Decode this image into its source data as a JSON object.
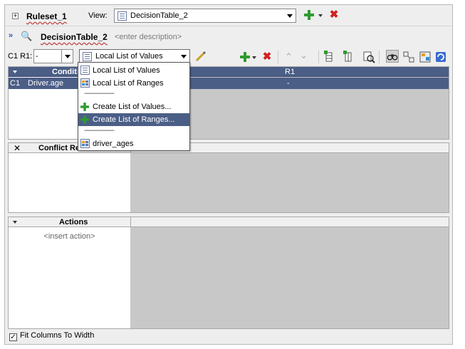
{
  "ruleset": {
    "title": "Ruleset_1",
    "view_label": "View:",
    "view_value": "DecisionTable_2"
  },
  "decision_table": {
    "title": "DecisionTable_2",
    "description_placeholder": "<enter description>"
  },
  "toolbar": {
    "c1_label": "C1 R1:",
    "c1_value": "-",
    "lov_value": "Local List of Values"
  },
  "conditions": {
    "header": "Conditi",
    "rule_header": "R1",
    "rows": [
      {
        "id": "C1",
        "name": "Driver.age",
        "r1": "-"
      }
    ]
  },
  "conflicts": {
    "header": "Conflict Re"
  },
  "actions": {
    "header": "Actions",
    "insert_placeholder": "<insert action>"
  },
  "dropdown_menu": {
    "items": [
      {
        "label": "Local List of Values",
        "icon": "list-icon"
      },
      {
        "label": "Local List of Ranges",
        "icon": "range-icon"
      },
      {
        "label": "------------------",
        "separator": true
      },
      {
        "label": "Create List of Values...",
        "icon": "plus-icon"
      },
      {
        "label": "Create List of Ranges...",
        "icon": "plus-icon",
        "highlighted": true
      },
      {
        "label": "------------------",
        "separator": true
      },
      {
        "label": "driver_ages",
        "icon": "range-icon"
      }
    ]
  },
  "footer": {
    "fit_columns": "Fit Columns To Width",
    "fit_checked": true
  },
  "colors": {
    "selection": "#4b5e86",
    "add_green": "#2e9b2e",
    "delete_red": "#d02020"
  }
}
